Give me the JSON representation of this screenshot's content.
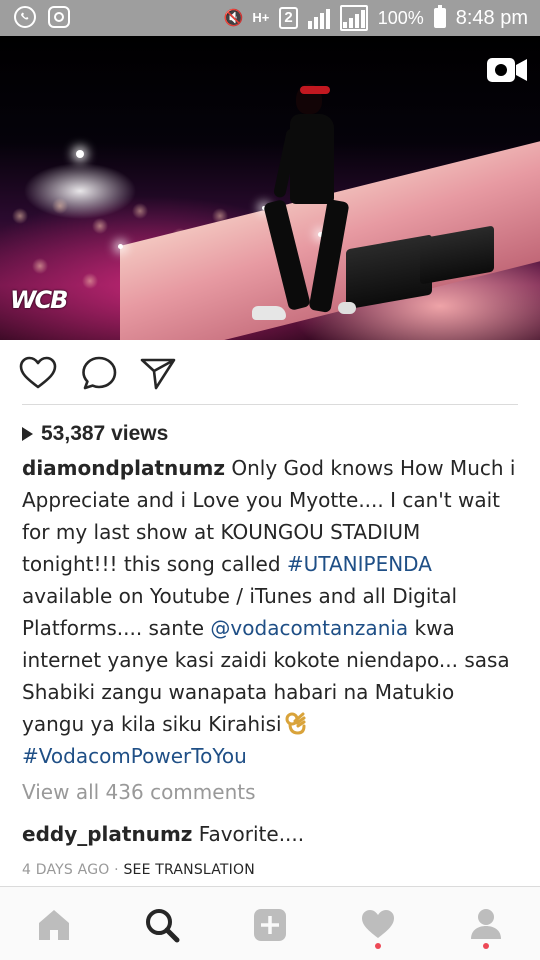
{
  "status_bar": {
    "network": "H+",
    "sim": "2",
    "battery": "100%",
    "time": "8:48 pm"
  },
  "post": {
    "media_watermark": "WCB",
    "views": "53,387 views",
    "caption": {
      "username": "diamondplatnumz",
      "text_1": " Only God knows How Much i Appreciate and i Love you Myotte.... I can't wait for my last show at KOUNGOU STADIUM tonight!!! this song called ",
      "hashtag_1": "#UTANIPENDA",
      "text_2": " available on Youtube / iTunes and all Digital Platforms.... sante ",
      "mention": "@vodacomtanzania",
      "text_3": " kwa internet yanye kasi zaidi kokote niendapo... sasa Shabiki zangu wanapata habari na Matukio yangu ya kila siku Kirahisi",
      "hashtag_2": "#VodacomPowerToYou"
    },
    "view_all_comments": "View all 436 comments",
    "comment": {
      "username": "eddy_platnumz",
      "text": " Favorite...."
    },
    "time_ago": "4 DAYS AGO",
    "separator": " · ",
    "see_translation": "SEE TRANSLATION"
  },
  "colors": {
    "text": "#262626",
    "muted": "#999999",
    "link": "#1f4f86",
    "notification_dot": "#ed4956"
  },
  "icons": {
    "status": [
      "whatsapp-icon",
      "instagram-icon",
      "mute-icon",
      "signal-icon",
      "battery-icon"
    ],
    "actions": [
      "heart-icon",
      "comment-icon",
      "share-icon"
    ],
    "nav": [
      "home-icon",
      "search-icon",
      "add-icon",
      "heart-icon",
      "profile-icon"
    ],
    "media": "video-camera-icon"
  }
}
